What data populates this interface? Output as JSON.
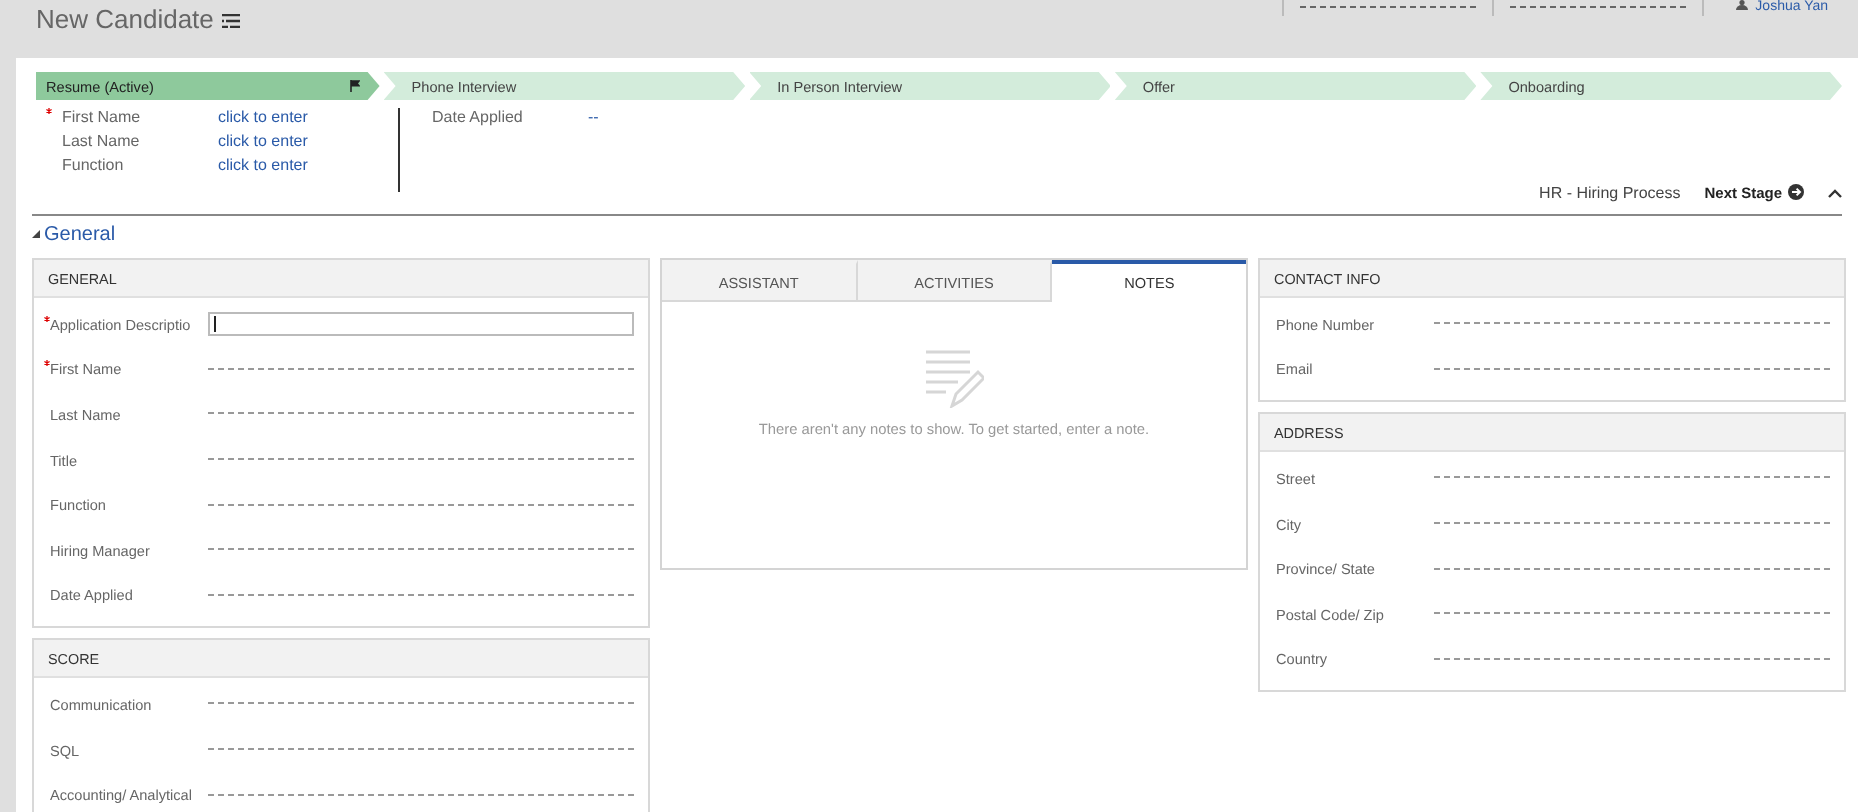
{
  "header": {
    "title": "New Candidate",
    "user_name": "Joshua Yan"
  },
  "process": {
    "stages": [
      {
        "label": "Resume (Active)",
        "selected": true
      },
      {
        "label": "Phone Interview",
        "selected": false
      },
      {
        "label": "In Person Interview",
        "selected": false
      },
      {
        "label": "Offer",
        "selected": false
      },
      {
        "label": "Onboarding",
        "selected": false
      }
    ],
    "fields": [
      {
        "label": "First Name",
        "required": true,
        "value": "click to enter"
      },
      {
        "label": "Last Name",
        "required": false,
        "value": "click to enter"
      },
      {
        "label": "Function",
        "required": false,
        "value": "click to enter"
      }
    ],
    "side_fields": [
      {
        "label": "Date Applied",
        "value": "--"
      }
    ],
    "process_name": "HR - Hiring Process",
    "next_stage": "Next Stage"
  },
  "section": {
    "title": "General",
    "expanded": true
  },
  "left_cards": [
    {
      "title": "GENERAL",
      "fields": [
        {
          "label": "Application Descriptio",
          "required": true,
          "kind": "input"
        },
        {
          "label": "First Name",
          "required": true,
          "kind": "line"
        },
        {
          "label": "Last Name",
          "required": false,
          "kind": "line"
        },
        {
          "label": "Title",
          "required": false,
          "kind": "line"
        },
        {
          "label": "Function",
          "required": false,
          "kind": "line"
        },
        {
          "label": "Hiring Manager",
          "required": false,
          "kind": "line"
        },
        {
          "label": "Date Applied",
          "required": false,
          "kind": "line"
        }
      ]
    },
    {
      "title": "SCORE",
      "fields": [
        {
          "label": "Communication",
          "required": false,
          "kind": "line"
        },
        {
          "label": "SQL",
          "required": false,
          "kind": "line"
        },
        {
          "label": "Accounting/ Analytical",
          "required": false,
          "kind": "line"
        }
      ]
    }
  ],
  "tab_panel": {
    "tabs": [
      {
        "label": "ASSISTANT",
        "selected": false
      },
      {
        "label": "ACTIVITIES",
        "selected": false
      },
      {
        "label": "NOTES",
        "selected": true
      }
    ],
    "empty_message": "There aren't any notes to show. To get started, enter a note."
  },
  "right_cards": [
    {
      "title": "CONTACT INFO",
      "fields": [
        {
          "label": "Phone Number",
          "required": false,
          "kind": "line"
        },
        {
          "label": "Email",
          "required": false,
          "kind": "line"
        }
      ]
    },
    {
      "title": "ADDRESS",
      "fields": [
        {
          "label": "Street",
          "required": false,
          "kind": "line"
        },
        {
          "label": "City",
          "required": false,
          "kind": "line"
        },
        {
          "label": "Province/ State",
          "required": false,
          "kind": "line"
        },
        {
          "label": "Postal Code/ Zip",
          "required": false,
          "kind": "line"
        },
        {
          "label": "Country",
          "required": false,
          "kind": "line"
        }
      ]
    }
  ]
}
